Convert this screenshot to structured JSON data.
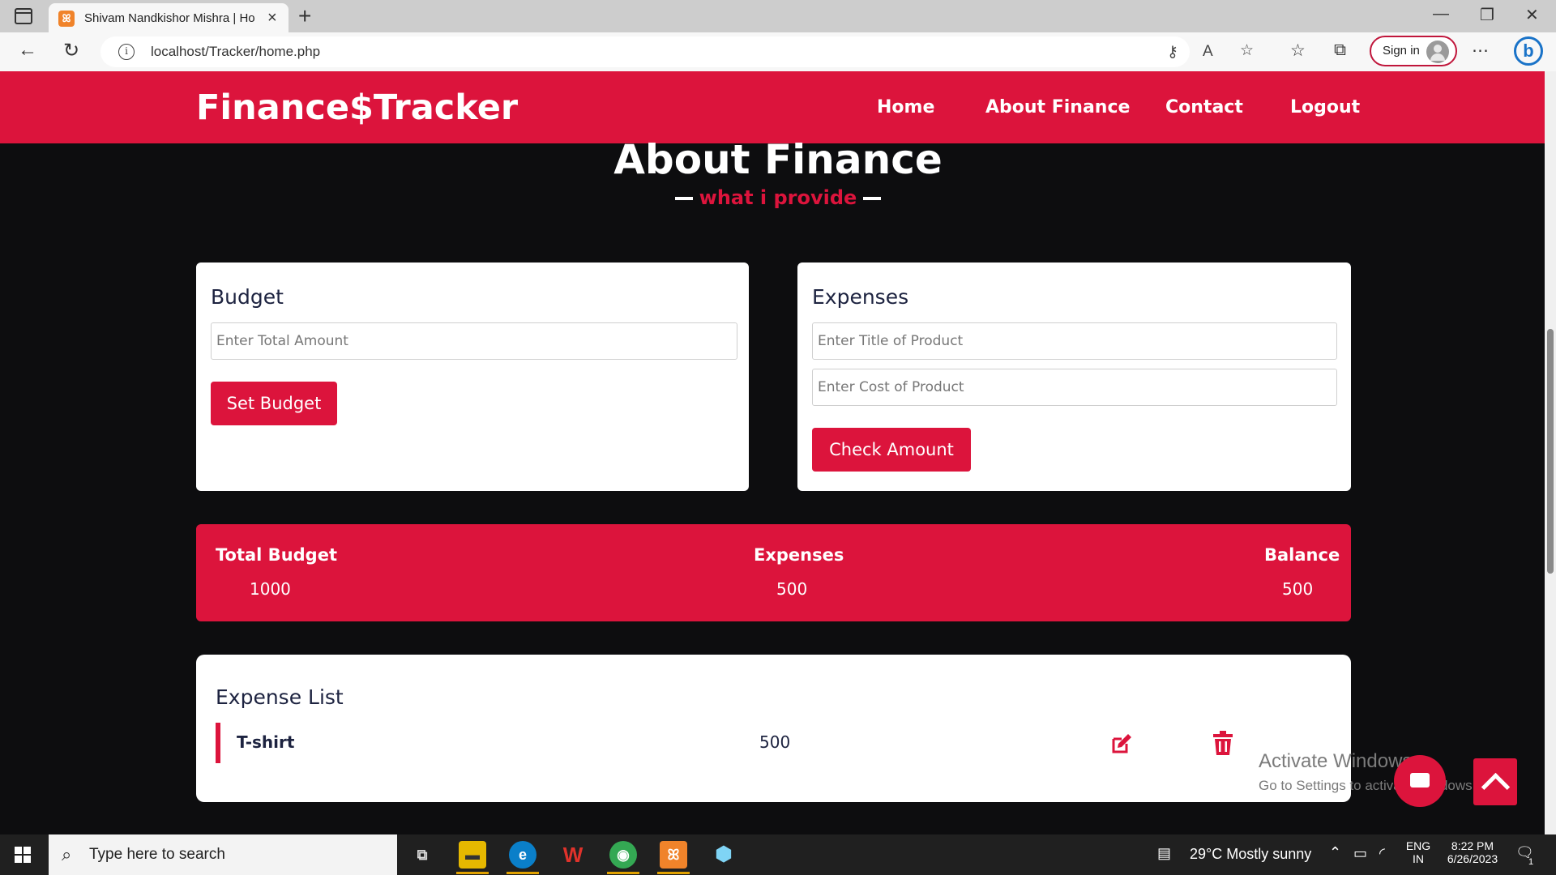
{
  "browser": {
    "tab_title": "Shivam Nandkishor Mishra | Hom",
    "tab_favicon": "xampp-icon",
    "url": "localhost/Tracker/home.php",
    "signin_label": "Sign in"
  },
  "navbar": {
    "brand": "Finance$Tracker",
    "links": [
      "Home",
      "About Finance",
      "Contact",
      "Logout"
    ],
    "accent": "#dc143c"
  },
  "section": {
    "title": "About Finance",
    "subtitle": "what i provide"
  },
  "budget_card": {
    "heading": "Budget",
    "amount_placeholder": "Enter Total Amount",
    "button": "Set Budget"
  },
  "expenses_card": {
    "heading": "Expenses",
    "title_placeholder": "Enter Title of Product",
    "cost_placeholder": "Enter Cost of Product",
    "button": "Check Amount"
  },
  "summary": {
    "total_budget_label": "Total Budget",
    "total_budget_value": "1000",
    "expenses_label": "Expenses",
    "expenses_value": "500",
    "balance_label": "Balance",
    "balance_value": "500"
  },
  "expense_list": {
    "heading": "Expense List",
    "items": [
      {
        "title": "T-shirt",
        "amount": "500",
        "edit_icon": "edit-icon",
        "delete_icon": "trash-icon"
      }
    ]
  },
  "watermark": {
    "line1": "Activate Windows",
    "line2": "Go to Settings to activate Windows."
  },
  "taskbar": {
    "search_placeholder": "Type here to search",
    "weather": "29°C  Mostly sunny",
    "lang_1": "ENG",
    "lang_2": "IN",
    "time": "8:22 PM",
    "date": "6/26/2023",
    "notification_count": "1"
  }
}
